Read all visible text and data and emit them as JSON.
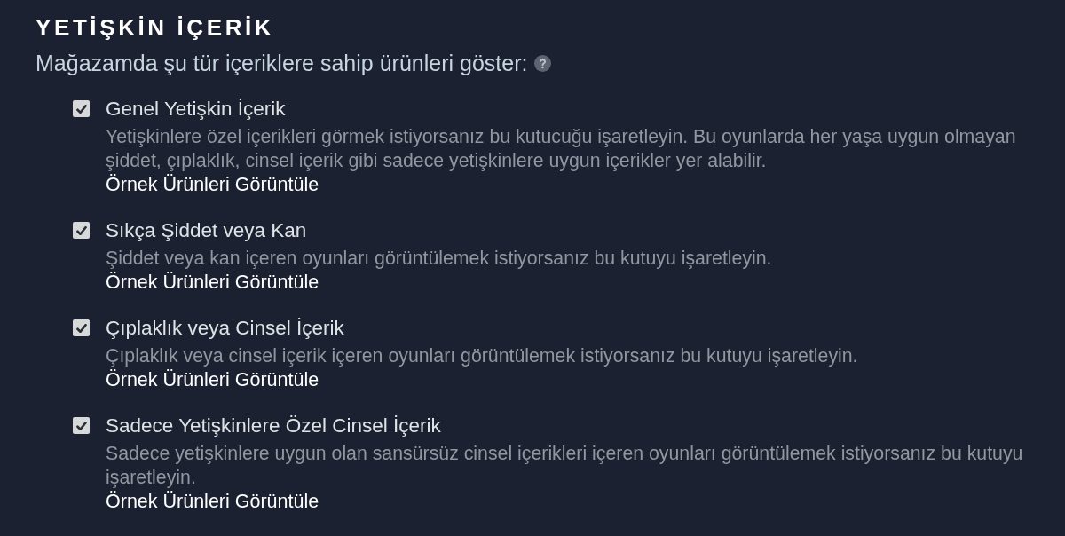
{
  "section": {
    "title": "YETİŞKİN İÇERİK",
    "subtitle": "Mağazamda şu tür içeriklere sahip ürünleri göster:"
  },
  "items": [
    {
      "label": "Genel Yetişkin İçerik",
      "checked": true,
      "description_lines": [
        "Yetişkinlere özel içerikleri görmek istiyorsanız bu kutucuğu işaretleyin. Bu oyunlarda her yaşa uygun olmayan",
        "şiddet, çıplaklık, cinsel içerik gibi sadece yetişkinlere uygun içerikler yer alabilir."
      ],
      "link": "Örnek Ürünleri Görüntüle"
    },
    {
      "label": "Sıkça Şiddet veya Kan",
      "checked": true,
      "description_lines": [
        "Şiddet veya kan içeren oyunları görüntülemek istiyorsanız bu kutuyu işaretleyin."
      ],
      "link": "Örnek Ürünleri Görüntüle"
    },
    {
      "label": "Çıplaklık veya Cinsel İçerik",
      "checked": true,
      "description_lines": [
        "Çıplaklık veya cinsel içerik içeren oyunları görüntülemek istiyorsanız bu kutuyu işaretleyin."
      ],
      "link": "Örnek Ürünleri Görüntüle"
    },
    {
      "label": "Sadece Yetişkinlere Özel Cinsel İçerik",
      "checked": true,
      "description_lines": [
        "Sadece yetişkinlere uygun olan sansürsüz cinsel içerikleri içeren oyunları görüntülemek istiyorsanız bu kutuyu",
        "işaretleyin."
      ],
      "link": "Örnek Ürünleri Görüntüle"
    }
  ]
}
